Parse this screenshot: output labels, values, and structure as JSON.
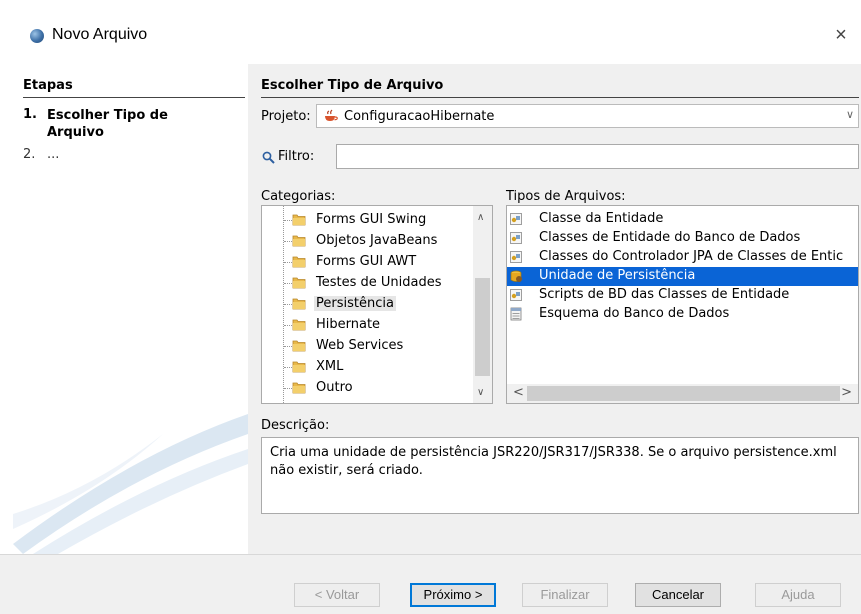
{
  "window": {
    "title": "Novo Arquivo",
    "close_symbol": "×"
  },
  "steps": {
    "header": "Etapas",
    "items": [
      {
        "number": "1.",
        "label": "Escolher Tipo de Arquivo"
      },
      {
        "number": "2.",
        "label": "..."
      }
    ]
  },
  "main": {
    "header": "Escolher Tipo de Arquivo",
    "projeto": {
      "label": "Projeto:",
      "value": "ConfiguracaoHibernate"
    },
    "filtro": {
      "label": "Filtro:",
      "value": ""
    },
    "categorias": {
      "label": "Categorias:",
      "items": [
        {
          "label": "Forms GUI Swing"
        },
        {
          "label": "Objetos JavaBeans"
        },
        {
          "label": "Forms GUI AWT"
        },
        {
          "label": "Testes de Unidades"
        },
        {
          "label": "Persistência",
          "selected": true
        },
        {
          "label": "Hibernate"
        },
        {
          "label": "Web Services"
        },
        {
          "label": "XML"
        },
        {
          "label": "Outro"
        }
      ]
    },
    "tipos": {
      "label": "Tipos de Arquivos:",
      "items": [
        {
          "label": "Classe da Entidade",
          "icon": "entity-class-icon"
        },
        {
          "label": "Classes de Entidade do Banco de Dados",
          "icon": "entity-class-icon"
        },
        {
          "label": "Classes do Controlador JPA de Classes de Entic",
          "icon": "entity-class-icon"
        },
        {
          "label": "Unidade de Persistência",
          "icon": "persistence-unit-icon",
          "selected": true
        },
        {
          "label": "Scripts de BD das Classes de Entidade",
          "icon": "entity-class-icon"
        },
        {
          "label": "Esquema do Banco de Dados",
          "icon": "database-schema-icon"
        }
      ]
    },
    "descricao": {
      "label": "Descrição:",
      "text": "Cria uma unidade de persistência JSR220/JSR317/JSR338. Se o arquivo persistence.xml não existir, será criado."
    }
  },
  "buttons": {
    "voltar": "< Voltar",
    "proximo": "Próximo >",
    "finalizar": "Finalizar",
    "cancelar": "Cancelar",
    "ajuda": "Ajuda"
  },
  "colors": {
    "selection": "#0a64d6",
    "default_button_border": "#0078d7"
  }
}
